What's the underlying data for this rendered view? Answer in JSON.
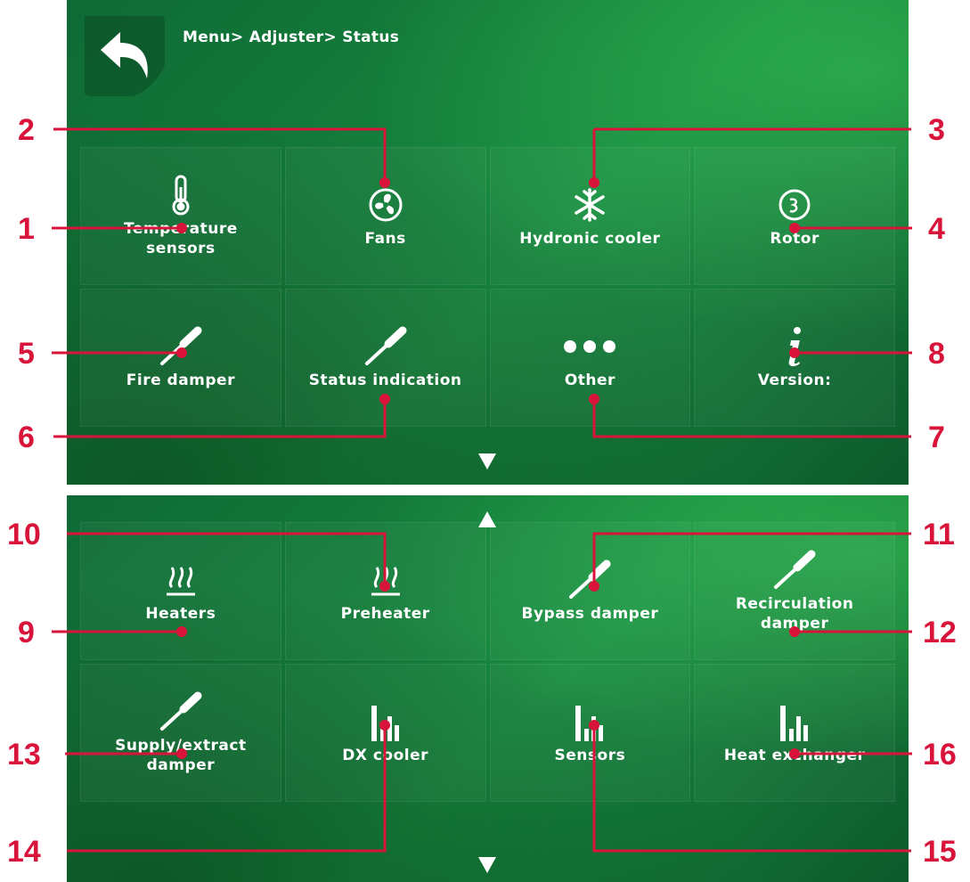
{
  "breadcrumb": "Menu> Adjuster> Status",
  "top_tiles": [
    {
      "label": "Temperature\nsensors",
      "icon": "thermometer-icon"
    },
    {
      "label": "Fans",
      "icon": "fan-icon"
    },
    {
      "label": "Hydronic cooler",
      "icon": "snowflake-icon"
    },
    {
      "label": "Rotor",
      "icon": "rotor-icon"
    },
    {
      "label": "Fire damper",
      "icon": "damper-icon"
    },
    {
      "label": "Status indication",
      "icon": "damper-icon"
    },
    {
      "label": "Other",
      "icon": "dots-icon"
    },
    {
      "label": "Version:",
      "icon": "info-icon"
    }
  ],
  "bottom_tiles": [
    {
      "label": "Heaters",
      "icon": "heater-icon"
    },
    {
      "label": "Preheater",
      "icon": "heater-icon"
    },
    {
      "label": "Bypass damper",
      "icon": "damper-icon"
    },
    {
      "label": "Recirculation\ndamper",
      "icon": "damper-icon"
    },
    {
      "label": "Supply/extract\ndamper",
      "icon": "damper-icon"
    },
    {
      "label": "DX cooler",
      "icon": "bar-chart-icon"
    },
    {
      "label": "Sensors",
      "icon": "bar-chart-icon"
    },
    {
      "label": "Heat exchanger",
      "icon": "bar-chart-icon"
    }
  ],
  "callouts": {
    "n1": "1",
    "n2": "2",
    "n3": "3",
    "n4": "4",
    "n5": "5",
    "n6": "6",
    "n7": "7",
    "n8": "8",
    "n9": "9",
    "n10": "10",
    "n11": "11",
    "n12": "12",
    "n13": "13",
    "n14": "14",
    "n15": "15",
    "n16": "16"
  },
  "colors": {
    "callout": "#d8143a",
    "panel": "#17893f"
  }
}
